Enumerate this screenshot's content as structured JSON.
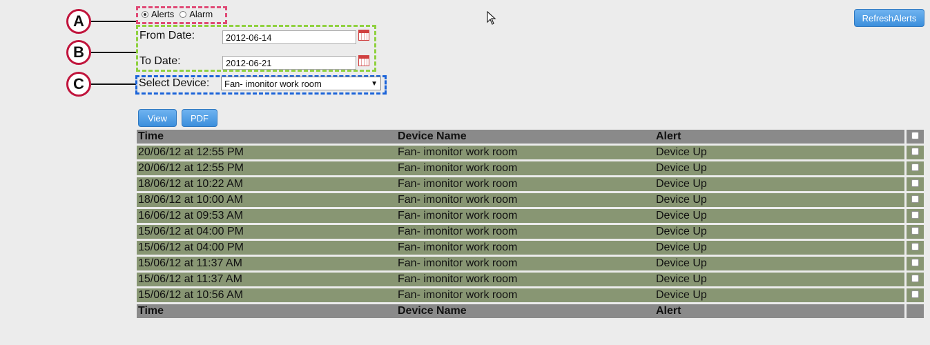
{
  "callouts": [
    "A",
    "B",
    "C"
  ],
  "mode": {
    "options": [
      {
        "label": "Alerts",
        "selected": true
      },
      {
        "label": "Alarm",
        "selected": false
      }
    ]
  },
  "dates": {
    "from_label": "From Date:",
    "from_value": "2012-06-14",
    "to_label": "To Date:",
    "to_value": "2012-06-21"
  },
  "device": {
    "label": "Select Device:",
    "selected": "Fan- imonitor work room"
  },
  "toolbar": {
    "view_label": "View",
    "pdf_label": "PDF",
    "refresh_label": "RefreshAlerts"
  },
  "table": {
    "headers": [
      "Time",
      "Device Name",
      "Alert"
    ],
    "rows": [
      [
        "20/06/12 at 12:55 PM",
        "Fan- imonitor work room",
        "Device Up"
      ],
      [
        "20/06/12 at 12:55 PM",
        "Fan- imonitor work room",
        "Device Up"
      ],
      [
        "18/06/12 at 10:22 AM",
        "Fan- imonitor work room",
        "Device Up"
      ],
      [
        "18/06/12 at 10:00 AM",
        "Fan- imonitor work room",
        "Device Up"
      ],
      [
        "16/06/12 at 09:53 AM",
        "Fan- imonitor work room",
        "Device Up"
      ],
      [
        "15/06/12 at 04:00 PM",
        "Fan- imonitor work room",
        "Device Up"
      ],
      [
        "15/06/12 at 04:00 PM",
        "Fan- imonitor work room",
        "Device Up"
      ],
      [
        "15/06/12 at 11:37 AM",
        "Fan- imonitor work room",
        "Device Up"
      ],
      [
        "15/06/12 at 11:37 AM",
        "Fan- imonitor work room",
        "Device Up"
      ],
      [
        "15/06/12 at 10:56 AM",
        "Fan- imonitor work room",
        "Device Up"
      ]
    ],
    "footers": [
      "Time",
      "Device Name",
      "Alert"
    ]
  },
  "colors": {
    "callout_ring": "#c0143c",
    "box_a": "#e04a76",
    "box_b": "#8fd13f",
    "box_c": "#1a63d9",
    "row_bg": "#889673",
    "header_bg": "#8a8a8a",
    "button": "#3c8fdc"
  }
}
